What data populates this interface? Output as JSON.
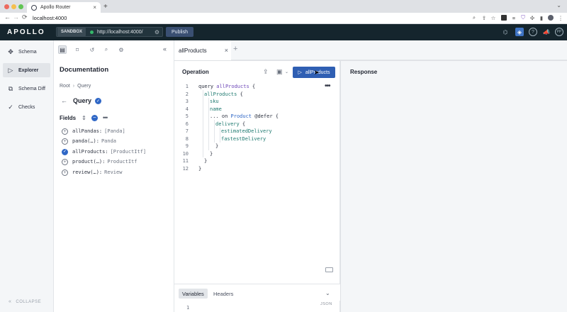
{
  "browser": {
    "tab_title": "Apollo Router",
    "tab_close": "×",
    "new_tab": "+",
    "tab_more": "⌄",
    "url": "localhost:4000",
    "nav_back": "←",
    "nav_forward": "→",
    "nav_reload": "⟳"
  },
  "header": {
    "logo": "APOLLO",
    "sandbox_label": "SANDBOX",
    "endpoint": "http://localhost:4000/",
    "publish_label": "Publish",
    "status_color": "#35b86a"
  },
  "leftnav": {
    "items": [
      {
        "label": "Schema",
        "icon": "schema-icon",
        "active": false
      },
      {
        "label": "Explorer",
        "icon": "explorer-icon",
        "active": true
      },
      {
        "label": "Schema Diff",
        "icon": "schema-diff-icon",
        "active": false
      },
      {
        "label": "Checks",
        "icon": "checks-icon",
        "active": false
      }
    ],
    "collapse_label": "COLLAPSE"
  },
  "docs": {
    "title": "Documentation",
    "breadcrumb": {
      "root": "Root",
      "sep": "›",
      "current": "Query"
    },
    "type_name": "Query",
    "fields_label": "Fields",
    "fields": [
      {
        "name": "allPandas:",
        "type": "[Panda]",
        "selected": false
      },
      {
        "name": "panda(…):",
        "type": "Panda",
        "selected": false
      },
      {
        "name": "allProducts:",
        "type": "[ProductItf]",
        "selected": true
      },
      {
        "name": "product(…):",
        "type": "ProductItf",
        "selected": false
      },
      {
        "name": "review(…):",
        "type": "Review",
        "selected": false
      }
    ]
  },
  "tabs": {
    "collapse_glyph": "«",
    "active_tab": "allProducts",
    "close": "×",
    "add": "+"
  },
  "operation": {
    "title": "Operation",
    "run_label": "allProducts",
    "more": "•••",
    "lines": [
      "1",
      "2",
      "3",
      "4",
      "5",
      "6",
      "7",
      "8",
      "9",
      "10",
      "11",
      "12"
    ]
  },
  "variables": {
    "tab_variables": "Variables",
    "tab_headers": "Headers",
    "format": "JSON",
    "first_line": "1"
  },
  "response": {
    "title": "Response"
  },
  "colors": {
    "header_bg": "#15252d",
    "accent": "#2f5fb3",
    "field_color": "#1f7a70",
    "operation_color": "#6e48b8"
  }
}
